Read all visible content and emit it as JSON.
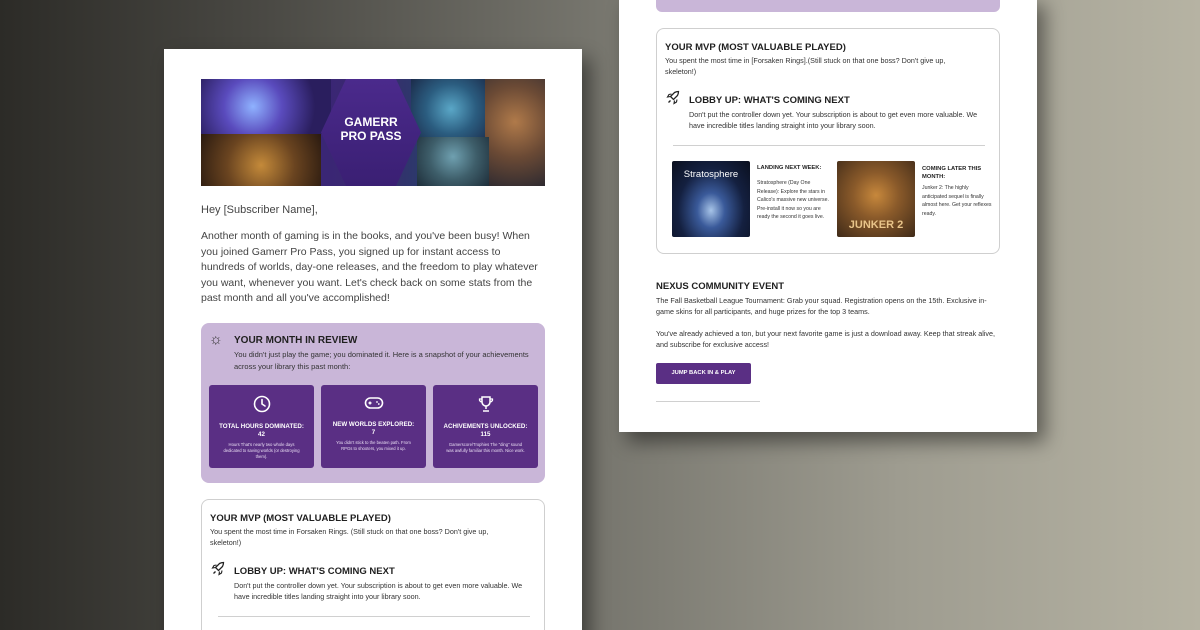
{
  "colors": {
    "accent": "#5a2f84",
    "panel": "#c9b6d8",
    "card_border": "#cfcfcf"
  },
  "banner": {
    "title": "GAMERR\nPRO PASS"
  },
  "email": {
    "greeting": "Hey [Subscriber Name],",
    "intro": "Another month of gaming is in the books, and you've been busy! When you joined Gamerr Pro Pass, you signed up for instant access to hundreds of worlds, day-one releases, and the freedom to play whatever you want, whenever you want. Let's check back on some stats from the past month and all you've accomplished!"
  },
  "review": {
    "icon": "sun-icon",
    "title": "YOUR MONTH IN REVIEW",
    "subtitle": "You didn't just play the game; you dominated it. Here is a snapshot of your achievements across your library this past month:",
    "stats": [
      {
        "icon": "clock-icon",
        "label": "TOTAL HOURS DOMINATED: 42",
        "desc": "Hours That's nearly two whole days dedicated to saving worlds (or destroying them)."
      },
      {
        "icon": "gamepad-icon",
        "label": "NEW WORLDS EXPLORED: 7",
        "desc": "You didn't stick to the beaten path. From RPGs to shooters, you mixed it up."
      },
      {
        "icon": "trophy-icon",
        "label": "ACHIVEMENTS UNLOCKED: 115",
        "desc": "Gamerscore/Trophies The \"ding\" sound was awfully familiar this month. Nice work."
      }
    ]
  },
  "mvp_left": {
    "title": "YOUR MVP (MOST VALUABLE PLAYED)",
    "text": "You spent the most time in Forsaken Rings. (Still stuck on that one boss? Don't give up, skeleton!)"
  },
  "lobby_left": {
    "icon": "rocket-icon",
    "title": "LOBBY UP: WHAT'S COMING NEXT",
    "text": "Don't put the controller down yet. Your subscription is about to get even more valuable. We have incredible titles landing straight into your library soon."
  },
  "mvp_right": {
    "title": "YOUR MVP (MOST VALUABLE PLAYED)",
    "text": "You spent the most time in [Forsaken Rings].(Still stuck on that one boss? Don't give up, skeleton!)"
  },
  "lobby_right": {
    "icon": "rocket-icon",
    "title": "LOBBY UP: WHAT'S COMING NEXT",
    "text": "Don't put the controller down yet. Your subscription is about to get even more valuable. We have incredible titles landing straight into your library soon."
  },
  "games": [
    {
      "cover_title": "Stratosphere",
      "heading": "LANDING NEXT WEEK:",
      "desc": "Stratosphere (Day One Release): Explore the stars in Calico's massive new universe. Pre-install it now so you are ready the second it goes live."
    },
    {
      "cover_title": "JUNKER 2",
      "heading": "COMING LATER THIS MONTH:",
      "desc": "Junker 2: The highly anticipated sequel is finally almost here. Get your reflexes ready."
    }
  ],
  "community": {
    "title": "NEXUS COMMUNITY EVENT",
    "text": "The Fall Basketball League Tournament: Grab your squad. Registration opens on the 15th. Exclusive in-game skins for all participants, and huge prizes for the top 3 teams.",
    "closing": "You've already achieved a ton, but your next favorite game is just a download away. Keep that streak alive, and subscribe for exclusive access!",
    "cta": "JUMP BACK IN & PLAY"
  }
}
